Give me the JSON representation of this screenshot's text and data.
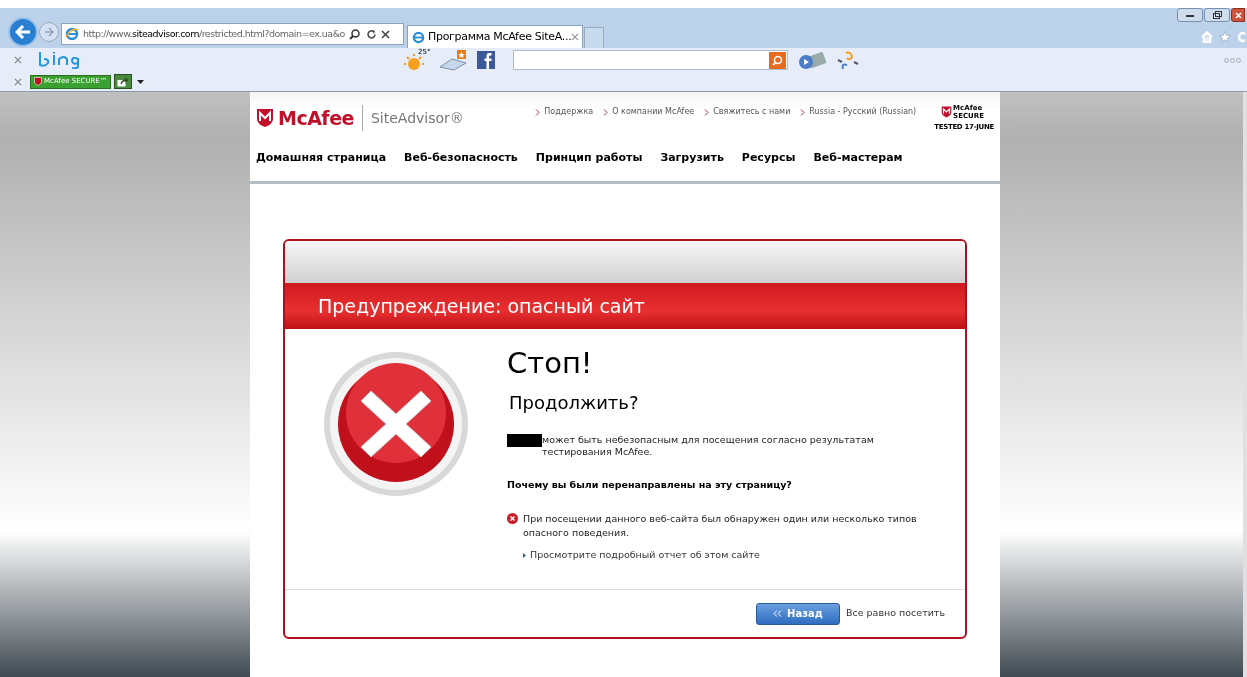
{
  "browser": {
    "address": {
      "prefix": "http://www.",
      "domain": "siteadvisor.com",
      "path": "/restricted.html?domain=ex.ua&o"
    },
    "tabs": [
      {
        "label": "Программа McAfee SiteA...",
        "selected": true
      }
    ],
    "weather": "25°",
    "toolbar_badge": "McAfee SECURE™"
  },
  "site": {
    "logo": "McAfee",
    "product": "SiteAdvisor®",
    "top_links": [
      "Поддержка",
      "О компании McAfee",
      "Свяжитесь с нами",
      "Russia - Русский (Russian)"
    ],
    "secure_badge": {
      "title": "McAfee SECURE",
      "caption": "TESTED 17-JUNE"
    },
    "nav": [
      "Домашняя страница",
      "Веб-безопасность",
      "Принцип работы",
      "Загрузить",
      "Ресурсы",
      "Веб-мастерам"
    ]
  },
  "warning": {
    "banner": "Предупреждение: опасный сайт",
    "heading": "Стоп!",
    "subheading": "Продолжить?",
    "message": "может быть небезопасным для посещения согласно результатам тестирования McAfee.",
    "reason_title": "Почему вы были перенаправлены на эту страницу?",
    "reasons": [
      "При посещении данного веб-сайта был обнаружен один или несколько типов опасного поведения."
    ],
    "report_link": "Просмотрите подробный отчет об этом сайте",
    "back_button": "Назад",
    "visit_link": "Все равно посетить"
  }
}
